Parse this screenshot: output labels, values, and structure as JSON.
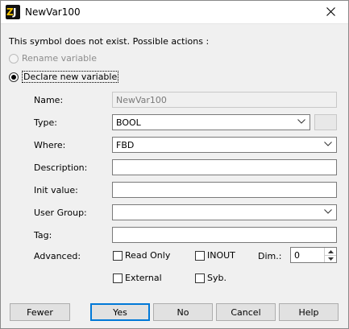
{
  "window": {
    "title": "NewVar100",
    "close_icon": "close-icon"
  },
  "message": "This symbol does not exist. Possible actions :",
  "options": {
    "rename": "Rename variable",
    "declare": "Declare new variable"
  },
  "form": {
    "name": {
      "label": "Name:",
      "value": "NewVar100"
    },
    "type": {
      "label": "Type:",
      "value": "BOOL"
    },
    "where": {
      "label": "Where:",
      "value": "FBD"
    },
    "description": {
      "label": "Description:",
      "value": ""
    },
    "init_value": {
      "label": "Init value:",
      "value": ""
    },
    "user_group": {
      "label": "User Group:",
      "value": ""
    },
    "tag": {
      "label": "Tag:",
      "value": ""
    },
    "advanced": {
      "label": "Advanced:",
      "read_only": "Read Only",
      "inout": "INOUT",
      "dim_label": "Dim.:",
      "dim_value": "0",
      "external": "External",
      "syb": "Syb."
    }
  },
  "buttons": {
    "fewer": "Fewer",
    "yes": "Yes",
    "no": "No",
    "cancel": "Cancel",
    "help": "Help"
  },
  "colors": {
    "accent": "#0078d7",
    "dialog_bg": "#f0f0f0"
  }
}
